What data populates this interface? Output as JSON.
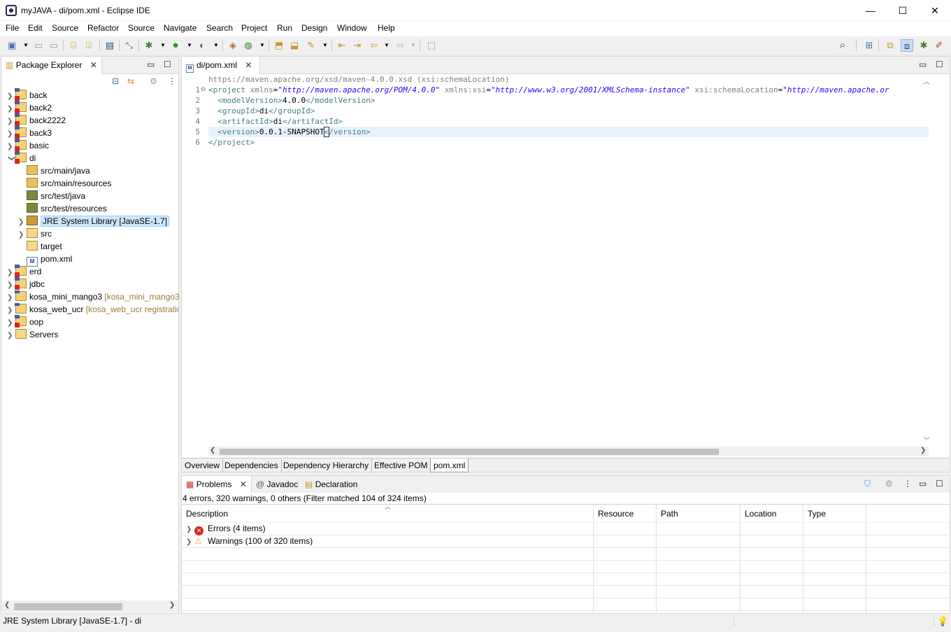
{
  "window": {
    "title": "myJAVA - di/pom.xml - Eclipse IDE",
    "minimize": "—",
    "maximize": "☐",
    "close": "✕"
  },
  "menu": [
    "File",
    "Edit",
    "Source",
    "Refactor",
    "Source",
    "Navigate",
    "Search",
    "Project",
    "Run",
    "Design",
    "Window",
    "Help"
  ],
  "package_explorer": {
    "tab_label": "Package Explorer",
    "tree": [
      {
        "label": "back",
        "icon": "project-error-icon"
      },
      {
        "label": "back2",
        "icon": "project-error-icon"
      },
      {
        "label": "back2222",
        "icon": "project-error-icon"
      },
      {
        "label": "back3",
        "icon": "project-error-icon"
      },
      {
        "label": "basic",
        "icon": "project-error-icon"
      },
      {
        "label": "di",
        "icon": "maven-project-icon"
      },
      {
        "label": "src/main/java",
        "icon": "source-folder-icon"
      },
      {
        "label": "src/main/resources",
        "icon": "source-folder-icon"
      },
      {
        "label": "src/test/java",
        "icon": "test-folder-icon"
      },
      {
        "label": "src/test/resources",
        "icon": "test-folder-icon"
      },
      {
        "label": "JRE System Library [JavaSE-1.7]",
        "icon": "library-icon"
      },
      {
        "label": "src",
        "icon": "folder-icon"
      },
      {
        "label": "target",
        "icon": "folder-icon"
      },
      {
        "label": "pom.xml",
        "icon": "xml-file-icon"
      },
      {
        "label": "erd",
        "icon": "project-error-icon"
      },
      {
        "label": "jdbc",
        "icon": "project-error-icon"
      },
      {
        "label": "kosa_mini_mango3",
        "decoration": "[kosa_mini_mango3",
        "icon": "project-icon"
      },
      {
        "label": "kosa_web_ucr",
        "decoration": "[kosa_web_ucr registratio",
        "icon": "project-icon"
      },
      {
        "label": "oop",
        "icon": "project-error-icon"
      },
      {
        "label": "Servers",
        "icon": "servers-folder-icon"
      }
    ]
  },
  "editor": {
    "tab_label": "di/pom.xml",
    "schema_hint": "https://maven.apache.org/xsd/maven-4.0.0.xsd (xsi:schemaLocation)",
    "line_numbers": [
      "1",
      "2",
      "3",
      "4",
      "5",
      "6"
    ],
    "lines": {
      "l1_open": "<",
      "l1_tag": "project",
      "l1_attr1": "xmlns",
      "l1_val1": "\"http://maven.apache.org/POM/4.0.0\"",
      "l1_attr2": "xmlns:xsi",
      "l1_val2": "\"http://www.w3.org/2001/XMLSchema-instance\"",
      "l1_attr3": "xsi:schemaLocation",
      "l1_val3": "\"http://maven.apache.or",
      "l2_tag": "modelVersion",
      "l2_text": "4.0.0",
      "l3_tag": "groupId",
      "l3_text": "di",
      "l4_tag": "artifactId",
      "l4_text": "di",
      "l5_tag": "version",
      "l5_text": "0.0.1-SNAPSHOT",
      "l6_tag": "project"
    },
    "bottom_tabs": [
      "Overview",
      "Dependencies",
      "Dependency Hierarchy",
      "Effective POM",
      "pom.xml"
    ]
  },
  "problems": {
    "tabs": [
      "Problems",
      "Javadoc",
      "Declaration"
    ],
    "summary": "4 errors, 320 warnings, 0 others (Filter matched 104 of 324 items)",
    "columns": [
      "Description",
      "Resource",
      "Path",
      "Location",
      "Type"
    ],
    "rows": [
      {
        "label": "Errors (4 items)",
        "icon": "error-icon"
      },
      {
        "label": "Warnings (100 of 320 items)",
        "icon": "warning-icon"
      }
    ]
  },
  "status": {
    "text": "JRE System Library [JavaSE-1.7] - di"
  }
}
